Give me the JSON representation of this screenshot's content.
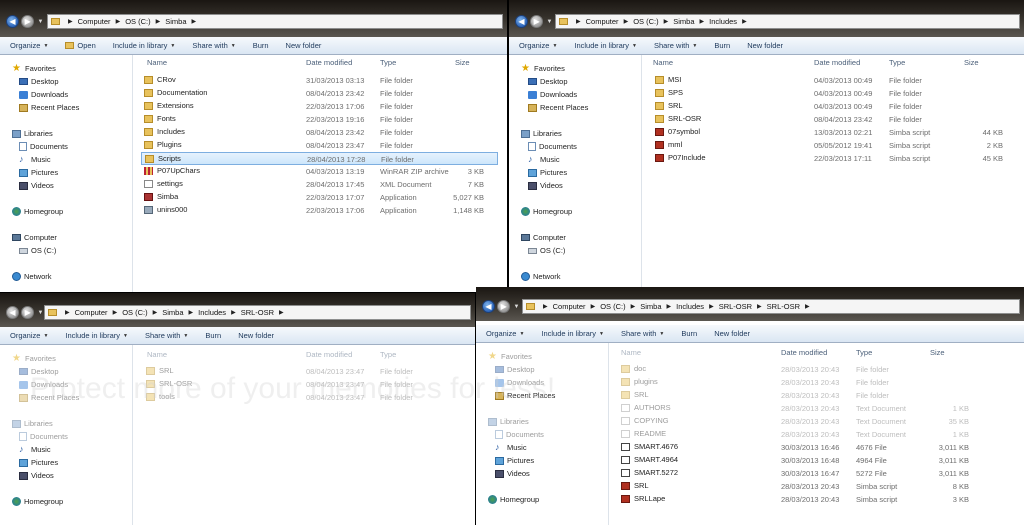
{
  "toolbar_common": {
    "organize": "Organize",
    "open": "Open",
    "include": "Include in library",
    "share": "Share with",
    "burn": "Burn",
    "newfolder": "New folder"
  },
  "columns": {
    "name": "Name",
    "date": "Date modified",
    "type": "Type",
    "size": "Size"
  },
  "nav": {
    "favorites": "Favorites",
    "desktop": "Desktop",
    "downloads": "Downloads",
    "recent": "Recent Places",
    "libraries": "Libraries",
    "documents": "Documents",
    "music": "Music",
    "pictures": "Pictures",
    "videos": "Videos",
    "homegroup": "Homegroup",
    "computer": "Computer",
    "osc": "OS (C:)",
    "network": "Network"
  },
  "w1": {
    "path": [
      "Computer",
      "OS (C:)",
      "Simba"
    ],
    "files": [
      {
        "name": "CRov",
        "date": "31/03/2013 03:13",
        "type": "File folder",
        "size": "",
        "icon": "folder"
      },
      {
        "name": "Documentation",
        "date": "08/04/2013 23:42",
        "type": "File folder",
        "size": "",
        "icon": "folder"
      },
      {
        "name": "Extensions",
        "date": "22/03/2013 17:06",
        "type": "File folder",
        "size": "",
        "icon": "folder"
      },
      {
        "name": "Fonts",
        "date": "22/03/2013 19:16",
        "type": "File folder",
        "size": "",
        "icon": "folder"
      },
      {
        "name": "Includes",
        "date": "08/04/2013 23:42",
        "type": "File folder",
        "size": "",
        "icon": "folder"
      },
      {
        "name": "Plugins",
        "date": "08/04/2013 23:47",
        "type": "File folder",
        "size": "",
        "icon": "folder"
      },
      {
        "name": "Scripts",
        "date": "28/04/2013 17:28",
        "type": "File folder",
        "size": "",
        "icon": "folder"
      },
      {
        "name": "P07UpChars",
        "date": "04/03/2013 13:19",
        "type": "WinRAR ZIP archive",
        "size": "3 KB",
        "icon": "zip"
      },
      {
        "name": "settings",
        "date": "28/04/2013 17:45",
        "type": "XML Document",
        "size": "7 KB",
        "icon": "xml"
      },
      {
        "name": "Simba",
        "date": "22/03/2013 17:07",
        "type": "Application",
        "size": "5,027 KB",
        "icon": "app"
      },
      {
        "name": "unins000",
        "date": "22/03/2013 17:06",
        "type": "Application",
        "size": "1,148 KB",
        "icon": "appw"
      }
    ]
  },
  "w2": {
    "path": [
      "Computer",
      "OS (C:)",
      "Simba",
      "Includes"
    ],
    "files": [
      {
        "name": "MSI",
        "date": "04/03/2013 00:49",
        "type": "File folder",
        "size": "",
        "icon": "folder"
      },
      {
        "name": "SPS",
        "date": "04/03/2013 00:49",
        "type": "File folder",
        "size": "",
        "icon": "folder"
      },
      {
        "name": "SRL",
        "date": "04/03/2013 00:49",
        "type": "File folder",
        "size": "",
        "icon": "folder"
      },
      {
        "name": "SRL-OSR",
        "date": "08/04/2013 23:42",
        "type": "File folder",
        "size": "",
        "icon": "folder"
      },
      {
        "name": "07symbol",
        "date": "13/03/2013 02:21",
        "type": "Simba script",
        "size": "44 KB",
        "icon": "script"
      },
      {
        "name": "mml",
        "date": "05/05/2012 19:41",
        "type": "Simba script",
        "size": "2 KB",
        "icon": "script"
      },
      {
        "name": "P07Include",
        "date": "22/03/2013 17:11",
        "type": "Simba script",
        "size": "45 KB",
        "icon": "script"
      }
    ]
  },
  "w3": {
    "path": [
      "Computer",
      "OS (C:)",
      "Simba",
      "Includes",
      "SRL-OSR"
    ],
    "files": [
      {
        "name": "SRL",
        "date": "08/04/2013 23:47",
        "type": "File folder",
        "size": "",
        "icon": "folder"
      },
      {
        "name": "SRL-OSR",
        "date": "08/04/2013 23:47",
        "type": "File folder",
        "size": "",
        "icon": "folder"
      },
      {
        "name": "tools",
        "date": "08/04/2013 23:47",
        "type": "File folder",
        "size": "",
        "icon": "folder"
      }
    ]
  },
  "w4": {
    "path": [
      "Computer",
      "OS (C:)",
      "Simba",
      "Includes",
      "SRL-OSR",
      "SRL-OSR"
    ],
    "files": [
      {
        "name": "doc",
        "date": "28/03/2013 20:43",
        "type": "File folder",
        "size": "",
        "icon": "folder"
      },
      {
        "name": "plugins",
        "date": "28/03/2013 20:43",
        "type": "File folder",
        "size": "",
        "icon": "folder"
      },
      {
        "name": "SRL",
        "date": "28/03/2013 20:43",
        "type": "File folder",
        "size": "",
        "icon": "folder"
      },
      {
        "name": "AUTHORS",
        "date": "28/03/2013 20:43",
        "type": "Text Document",
        "size": "1 KB",
        "icon": "txt"
      },
      {
        "name": "COPYING",
        "date": "28/03/2013 20:43",
        "type": "Text Document",
        "size": "35 KB",
        "icon": "txt"
      },
      {
        "name": "README",
        "date": "28/03/2013 20:43",
        "type": "Text Document",
        "size": "1 KB",
        "icon": "txt"
      },
      {
        "name": "SMART.4676",
        "date": "30/03/2013 16:46",
        "type": "4676 File",
        "size": "3,011 KB",
        "icon": "gen"
      },
      {
        "name": "SMART.4964",
        "date": "30/03/2013 16:48",
        "type": "4964 File",
        "size": "3,011 KB",
        "icon": "gen"
      },
      {
        "name": "SMART.5272",
        "date": "30/03/2013 16:47",
        "type": "5272 File",
        "size": "3,011 KB",
        "icon": "gen"
      },
      {
        "name": "SRL",
        "date": "28/03/2013 20:43",
        "type": "Simba script",
        "size": "8 KB",
        "icon": "script"
      },
      {
        "name": "SRLLape",
        "date": "28/03/2013 20:43",
        "type": "Simba script",
        "size": "3 KB",
        "icon": "script"
      }
    ]
  },
  "watermark": "Protect more of your memories for less!"
}
